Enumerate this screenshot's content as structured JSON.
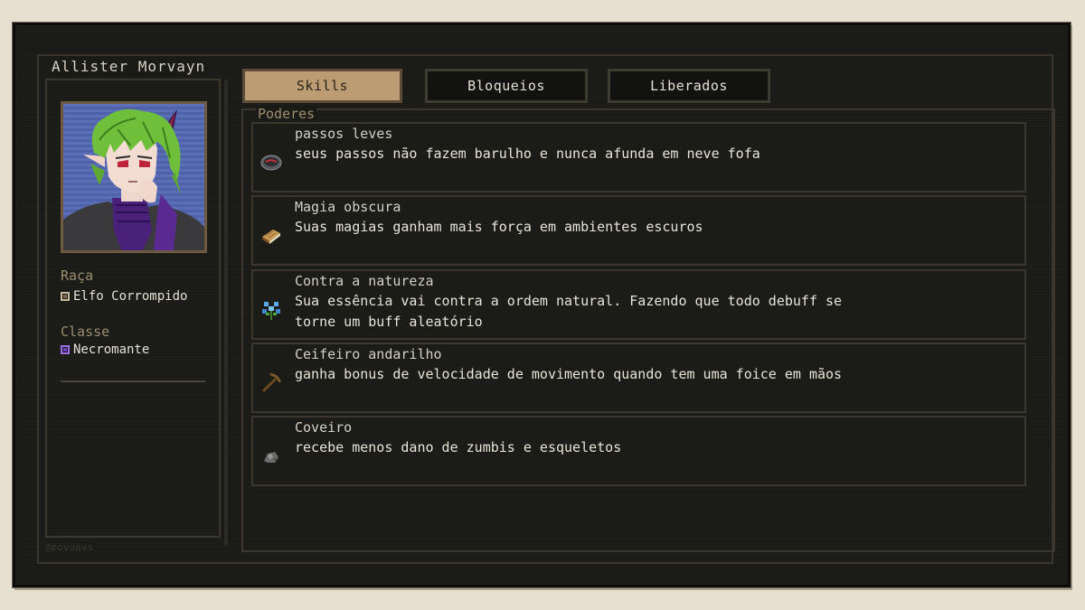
{
  "character": {
    "name": "Allister Morvayn"
  },
  "stats": {
    "race_label": "Raça",
    "race_value": "Elfo Corrompido",
    "class_label": "Classe",
    "class_value": "Necromante"
  },
  "watermark": "@povuavs",
  "tabs": [
    {
      "label": "Skills",
      "active": true
    },
    {
      "label": "Bloqueios",
      "active": false
    },
    {
      "label": "Liberados",
      "active": false
    }
  ],
  "section_title": "Poderes",
  "skills": [
    {
      "name": "passos leves",
      "desc": "seus passos não fazem barulho e nunca afunda em neve fofa",
      "icon": "compass-icon"
    },
    {
      "name": "Magia obscura",
      "desc": "Suas magias ganham mais força em ambientes escuros",
      "icon": "book-icon"
    },
    {
      "name": "Contra a natureza",
      "desc": "Sua essência vai contra a ordem natural. Fazendo que todo debuff se torne um buff aleatório",
      "icon": "blue-flower-icon"
    },
    {
      "name": "Ceifeiro andarilho",
      "desc": "ganha bonus de velocidade de movimento quando tem uma foice em mãos",
      "icon": "pickaxe-icon"
    },
    {
      "name": "Coveiro",
      "desc": "recebe menos dano de zumbis e esqueletos",
      "icon": "gravel-icon"
    }
  ],
  "colors": {
    "accent_tab": "#bc9d73",
    "panel_bg": "#1a1a17",
    "label": "#9c8d6c",
    "class_icon": "#9a6ee6"
  }
}
